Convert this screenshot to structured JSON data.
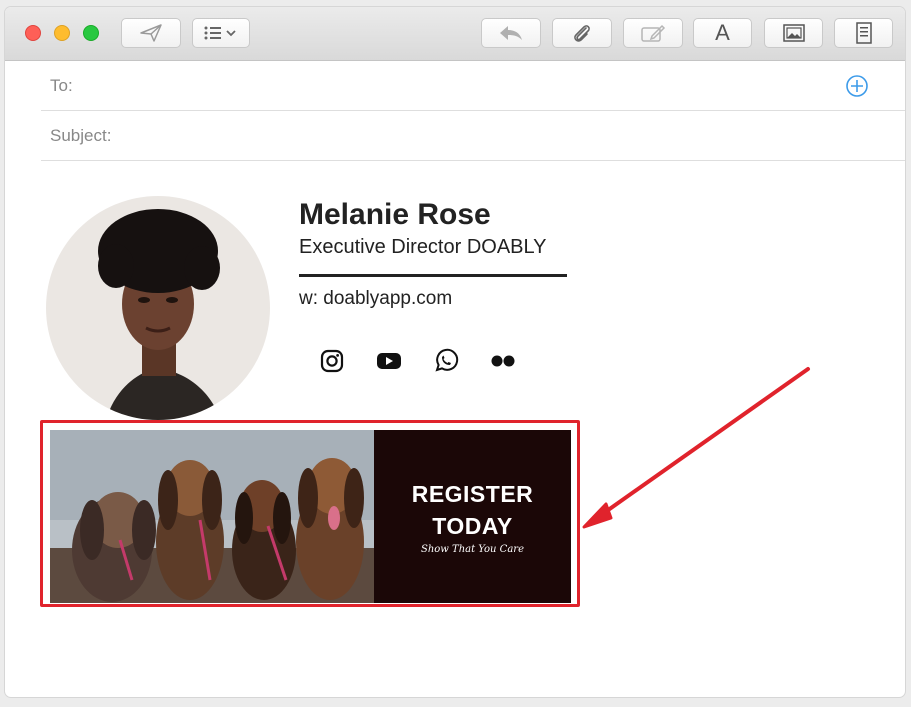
{
  "window": {
    "traffic_lights": [
      "close",
      "minimize",
      "zoom"
    ],
    "colors": {
      "close": "#fe5f57",
      "minimize": "#febc2e",
      "zoom": "#28c840"
    }
  },
  "toolbar": {
    "left_buttons": [
      "send-icon",
      "list-format-icon"
    ],
    "right_buttons": [
      "reply-icon",
      "paperclip-icon",
      "markup-icon",
      "font-icon",
      "photo-icon",
      "template-icon"
    ],
    "font_button_label": "A"
  },
  "compose": {
    "to_label": "To:",
    "to_value": "",
    "subject_label": "Subject:",
    "subject_value": "",
    "add_contact_icon": "plus-circle-icon"
  },
  "signature": {
    "name": "Melanie Rose",
    "title": "Executive Director DOABLY",
    "website": "w: doablyapp.com",
    "social_icons": [
      "instagram-icon",
      "youtube-icon",
      "whatsapp-icon",
      "flickr-icon"
    ]
  },
  "banner": {
    "headline_line1": "REGISTER",
    "headline_line2": "TODAY",
    "tagline": "Show That You Care",
    "highlight_color": "#e0232c"
  }
}
